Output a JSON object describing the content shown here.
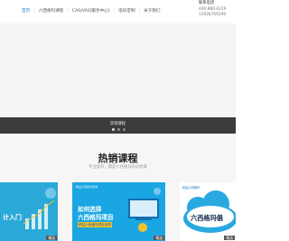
{
  "header": {
    "nav": [
      {
        "label": "首页"
      },
      {
        "label": "六西格玛课程"
      },
      {
        "label": "CAS/VAS[服务中心]"
      },
      {
        "label": "培训定制"
      },
      {
        "label": "关于我们"
      }
    ],
    "contact": {
      "label": "联系电话",
      "phone1": "400-880-6319",
      "phone2": "13926769299"
    }
  },
  "banner": {
    "caption": "热销课程"
  },
  "hot_courses": {
    "title": "热销课程",
    "subtitle": "专业提升，都是六西格玛的必修课",
    "cards": [
      {
        "text": "计入门",
        "tag": "精选"
      },
      {
        "top": "精益六西格玛咨询",
        "title_line1": "如何选择",
        "title_line2": "六西格玛项目",
        "button": "精益六西格玛项目选择",
        "tag": "精选"
      },
      {
        "logo": "精益六西格玛",
        "text": "六西格玛倡",
        "tag": "精选"
      }
    ]
  },
  "colors": {
    "accent": "#1a78c2",
    "caption_bar": "#3b3b3b",
    "card_blue": "#1aa6e2",
    "button_yellow": "#f2c12e"
  }
}
